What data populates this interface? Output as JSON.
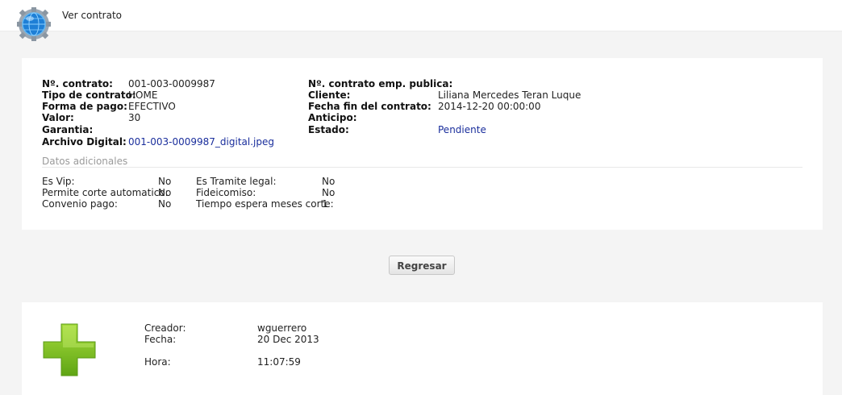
{
  "header": {
    "title": "Ver contrato",
    "icon": "globe-gear-icon"
  },
  "contract": {
    "left": [
      {
        "label": "Nº. contrato:",
        "value": "001-003-0009987"
      },
      {
        "label": "Tipo de contrato:",
        "value": "HOME"
      },
      {
        "label": "Forma de pago:",
        "value": "EFECTIVO"
      },
      {
        "label": "Valor:",
        "value": "30"
      },
      {
        "label": "Garantia:",
        "value": ""
      },
      {
        "label": "Archivo Digital:",
        "value": "001-003-0009987_digital.jpeg"
      }
    ],
    "right": [
      {
        "label": "Nº. contrato emp. publica:",
        "value": ""
      },
      {
        "label": "Cliente:",
        "value": "Liliana Mercedes Teran Luque"
      },
      {
        "label": "Fecha fin del contrato:",
        "value": "2014-12-20 00:00:00"
      },
      {
        "label": "Anticipo:",
        "value": ""
      },
      {
        "label": "Estado:",
        "value": "Pendiente"
      }
    ]
  },
  "additional": {
    "title": "Datos adicionales",
    "left": [
      {
        "label": "Es Vip:",
        "value": "No"
      },
      {
        "label": "Permite corte automatico:",
        "value": "No"
      },
      {
        "label": "Convenio pago:",
        "value": "No"
      }
    ],
    "right": [
      {
        "label": "Es Tramite legal:",
        "value": "No"
      },
      {
        "label": "Fideicomiso:",
        "value": "No"
      },
      {
        "label": "Tiempo espera meses corte:",
        "value": "1"
      }
    ]
  },
  "actions": {
    "back_label": "Regresar"
  },
  "audit": {
    "icon": "green-plus-icon",
    "creator_label": "Creador:",
    "creator": "wguerrero",
    "date_label": "Fecha:",
    "date": "20 Dec 2013",
    "time_label": "Hora:",
    "time": "11:07:59"
  },
  "colors": {
    "link": "#1a2e9c",
    "plus": "#7dc21e",
    "background": "#f4f4f4"
  }
}
